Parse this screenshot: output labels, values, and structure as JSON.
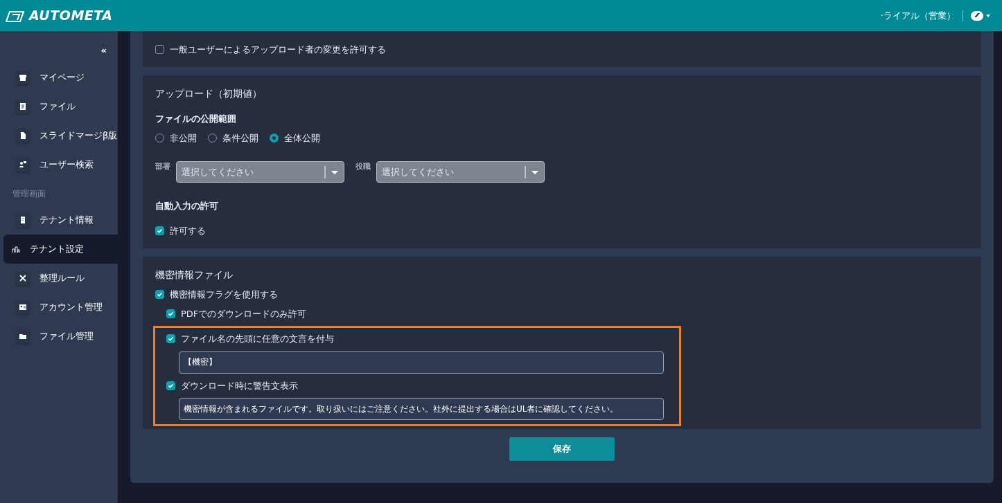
{
  "header": {
    "brand": "AUTOMETA",
    "user": "·ライアル（営業）"
  },
  "sidebar": {
    "collapse": "«",
    "items": [
      {
        "kind": "item",
        "label": "マイページ",
        "selected": false
      },
      {
        "kind": "item",
        "label": "ファイル",
        "selected": false
      },
      {
        "kind": "item",
        "label": "スライドマージβ版",
        "selected": false
      },
      {
        "kind": "item",
        "label": "ユーザー検索",
        "selected": false
      },
      {
        "kind": "section",
        "label": "管理画面"
      },
      {
        "kind": "item",
        "label": "テナント情報",
        "selected": false
      },
      {
        "kind": "item",
        "label": "テナント設定",
        "selected": true
      },
      {
        "kind": "item",
        "label": "整理ルール",
        "selected": false
      },
      {
        "kind": "item",
        "label": "アカウント管理",
        "selected": false
      },
      {
        "kind": "item",
        "label": "ファイル管理",
        "selected": false
      }
    ]
  },
  "uploader_card": {
    "checkbox": {
      "label": "一般ユーザーによるアップロード者の変更を許可する",
      "checked": false
    }
  },
  "upload_card": {
    "title": "アップロード（初期値）",
    "visibility_label": "ファイルの公開範囲",
    "radios": [
      {
        "label": "非公開",
        "selected": false
      },
      {
        "label": "条件公開",
        "selected": false
      },
      {
        "label": "全体公開",
        "selected": true
      }
    ],
    "selects": [
      {
        "label": "部署",
        "placeholder": "選択してください",
        "disabled": true
      },
      {
        "label": "役職",
        "placeholder": "選択してください",
        "disabled": true
      }
    ],
    "autofill_label": "自動入力の許可",
    "autofill": {
      "label": "許可する",
      "checked": true
    }
  },
  "confidential_card": {
    "title": "機密情報ファイル",
    "flag": {
      "label": "機密情報フラグを使用する",
      "checked": true,
      "children": [
        {
          "label": "PDFでのダウンロードのみ許可",
          "checked": true
        }
      ],
      "highlighted_children": [
        {
          "label": "ファイル名の先頭に任意の文言を付与",
          "checked": true,
          "value": "【機密】"
        },
        {
          "label": "ダウンロード時に警告文表示",
          "checked": true,
          "value": "機密情報が含まれるファイルです。取り扱いにはご注意ください。社外に提出する場合はUL者に確認してください。"
        }
      ]
    }
  },
  "save_button": "保存"
}
